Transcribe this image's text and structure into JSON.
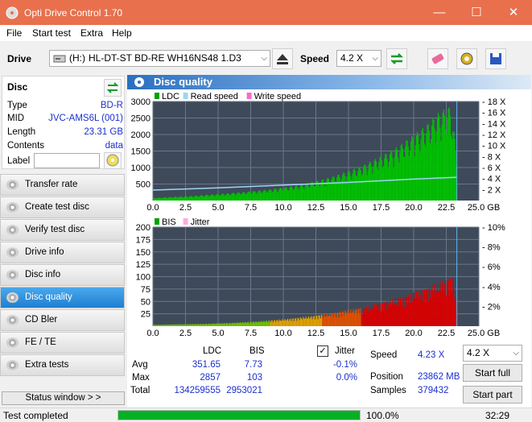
{
  "window": {
    "title": "Opti Drive Control 1.70",
    "minimize": "—",
    "maximize": "☐",
    "close": "✕"
  },
  "menu": [
    "File",
    "Start test",
    "Extra",
    "Help"
  ],
  "toolbar": {
    "drive_label": "Drive",
    "drive_letter": "(H:)",
    "drive_name": "HL-DT-ST BD-RE  WH16NS48 1.D3",
    "speed_label": "Speed",
    "speed_value": "4.2 X"
  },
  "disc": {
    "header": "Disc",
    "type_label": "Type",
    "type_value": "BD-R",
    "mid_label": "MID",
    "mid_value": "JVC-AMS6L (001)",
    "length_label": "Length",
    "length_value": "23.31 GB",
    "contents_label": "Contents",
    "contents_value": "data",
    "label_label": "Label",
    "label_value": ""
  },
  "nav": [
    "Transfer rate",
    "Create test disc",
    "Verify test disc",
    "Drive info",
    "Disc info",
    "Disc quality",
    "CD Bler",
    "FE / TE",
    "Extra tests"
  ],
  "nav_active": "Disc quality",
  "status_window_btn": "Status window > >",
  "panel_title": "Disc quality",
  "chart_data": [
    {
      "type": "area",
      "legend": [
        "LDC",
        "Read speed",
        "Write speed"
      ],
      "legend_colors": [
        "#00a000",
        "#9fd4f5",
        "#ff66cc"
      ],
      "x_ticks": [
        "0.0",
        "2.5",
        "5.0",
        "7.5",
        "10.0",
        "12.5",
        "15.0",
        "17.5",
        "20.0",
        "22.5",
        "25.0 GB"
      ],
      "y_ticks_left": [
        "3000",
        "2500",
        "2000",
        "1500",
        "1000",
        "500"
      ],
      "y_ticks_right": [
        "18 X",
        "16 X",
        "14 X",
        "12 X",
        "10 X",
        "8 X",
        "6 X",
        "4 X",
        "2 X"
      ],
      "xlim": [
        0,
        25
      ],
      "ylim": [
        0,
        3000
      ],
      "y2lim": [
        0,
        18
      ],
      "ldc": {
        "x": [
          0,
          1,
          2,
          3,
          4,
          5,
          6,
          7,
          8,
          9,
          10,
          11,
          12,
          13,
          14,
          15,
          16,
          17,
          18,
          19,
          20,
          21,
          22,
          22.8,
          23.3
        ],
        "y": [
          80,
          100,
          120,
          140,
          170,
          200,
          230,
          260,
          300,
          340,
          400,
          460,
          540,
          640,
          760,
          900,
          1050,
          1250,
          1450,
          1700,
          2000,
          2300,
          2700,
          2857,
          1500
        ]
      },
      "read_speed": {
        "x": [
          0,
          5,
          10,
          15,
          20,
          23.3
        ],
        "y": [
          1.9,
          2.3,
          2.8,
          3.3,
          3.9,
          4.23
        ]
      }
    },
    {
      "type": "area",
      "legend": [
        "BIS",
        "Jitter"
      ],
      "legend_colors": [
        "#00a000",
        "#ffaadd"
      ],
      "x_ticks": [
        "0.0",
        "2.5",
        "5.0",
        "7.5",
        "10.0",
        "12.5",
        "15.0",
        "17.5",
        "20.0",
        "22.5",
        "25.0 GB"
      ],
      "y_ticks_left": [
        "200",
        "175",
        "150",
        "125",
        "100",
        "75",
        "50",
        "25"
      ],
      "y_ticks_right": [
        "10%",
        "8%",
        "6%",
        "4%",
        "2%"
      ],
      "xlim": [
        0,
        25
      ],
      "ylim": [
        0,
        200
      ],
      "bis": {
        "x": [
          0,
          2,
          4,
          6,
          8,
          10,
          12,
          14,
          16,
          18,
          20,
          22,
          23,
          23.3
        ],
        "y": [
          3,
          4,
          5,
          7,
          10,
          14,
          20,
          28,
          38,
          52,
          68,
          90,
          103,
          40
        ]
      }
    }
  ],
  "stats": {
    "col_ldc": "LDC",
    "col_bis": "BIS",
    "avg_label": "Avg",
    "avg_ldc": "351.65",
    "avg_bis": "7.73",
    "avg_jitter": "-0.1%",
    "max_label": "Max",
    "max_ldc": "2857",
    "max_bis": "103",
    "max_jitter": "0.0%",
    "total_label": "Total",
    "total_ldc": "134259555",
    "total_bis": "2953021",
    "jitter_label": "Jitter",
    "jitter_checked": "✓",
    "speed_label": "Speed",
    "speed_value": "4.23 X",
    "position_label": "Position",
    "position_value": "23862 MB",
    "samples_label": "Samples",
    "samples_value": "379432",
    "speed_combo": "4.2 X",
    "start_full": "Start full",
    "start_part": "Start part"
  },
  "status": {
    "text": "Test completed",
    "progress": 1.0,
    "progress_text": "100.0%",
    "time": "32:29"
  }
}
